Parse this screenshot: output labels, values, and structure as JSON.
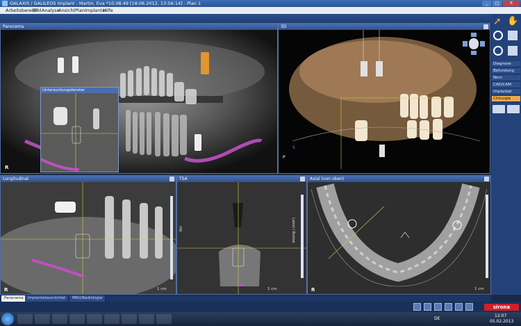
{
  "window": {
    "title": "GALAXIS / GALILEOS Implant - Martin, Eva *10.08.49 [18.06.2012, 13:56:14] - Plan 1",
    "controls": {
      "minimize": "_",
      "maximize": "□",
      "close": "X"
    }
  },
  "menu": [
    "Arbeitsbereich",
    "Bild",
    "Analyse",
    "Ansicht",
    "Plan",
    "Implantat",
    "Hilfe"
  ],
  "panels": {
    "panorama": {
      "title": "Panorama",
      "corner": "R"
    },
    "inset": {
      "title": "Untersuchungsfenster"
    },
    "view3d": {
      "title": "3D",
      "axis_s": "S",
      "axis_p": "P"
    },
    "longitudinal": {
      "title": "Longitudinal",
      "scale": "1 cm",
      "corner": "R"
    },
    "tsa": {
      "title": "TSA",
      "scale": "1 cm",
      "side_left": "Bkl",
      "side_right": "Labial / Bukkal"
    },
    "axial": {
      "title": "Axial (von oben)",
      "scale": "1 cm",
      "corner": "R"
    }
  },
  "right_sidebar": {
    "buttons": [
      "Diagnose",
      "Befundung",
      "Nerv",
      "CAD/CAM",
      "Implantat",
      "Chirurgie"
    ],
    "active": "Chirurgie"
  },
  "bottom_tabs": {
    "items": [
      "Panorama",
      "Implantatausrichtet",
      "MRU/Radiologie"
    ],
    "active": "Panorama"
  },
  "brand": "sirona",
  "taskbar": {
    "language": "DE",
    "time": "12:07",
    "date": "05.02.2013"
  },
  "colors": {
    "accent_orange": "#f1a64a",
    "nerve_magenta": "#c050c0",
    "guide_yellow": "#d8d040",
    "frame_blue": "#2f528f"
  }
}
